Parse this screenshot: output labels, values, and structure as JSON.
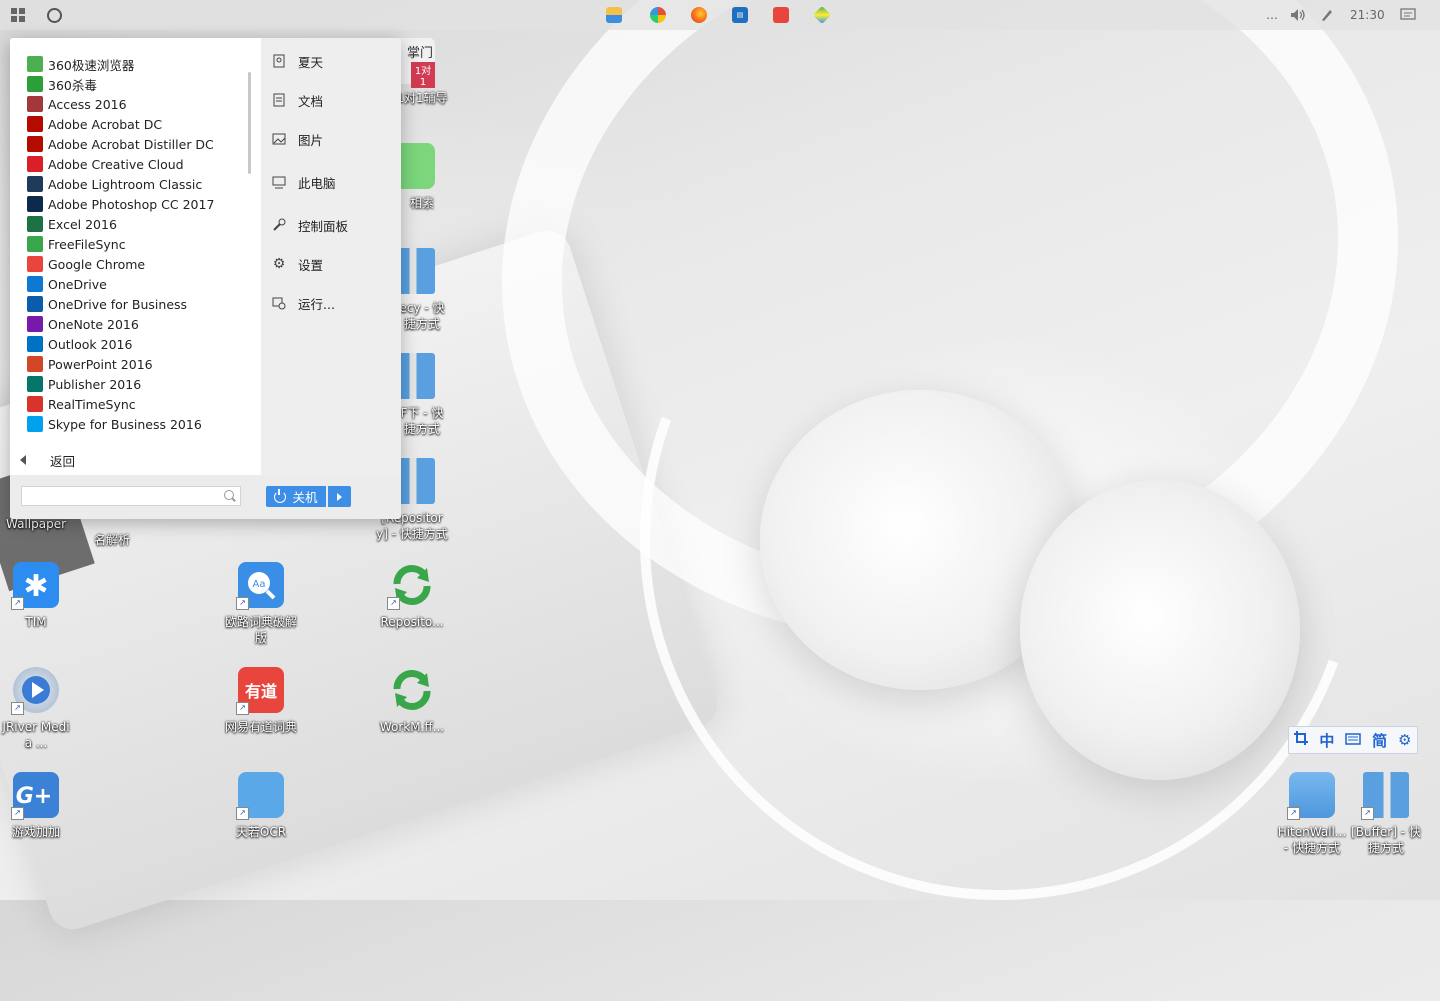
{
  "taskbar": {
    "pinned": [
      "folder-icon",
      "360-browser-icon",
      "firefox-icon",
      "dictionary-icon",
      "youdao-icon",
      "maps-icon"
    ],
    "tray": {
      "more": "…",
      "time": "21:30"
    }
  },
  "start_menu": {
    "apps": [
      {
        "label": "360极速浏览器",
        "icon": "360-browser-icon",
        "color": "#4caf50"
      },
      {
        "label": "360杀毒",
        "icon": "360-antivirus-icon",
        "color": "#2e9e3a"
      },
      {
        "label": "Access 2016",
        "icon": "access-icon",
        "color": "#a4373a"
      },
      {
        "label": "Adobe Acrobat DC",
        "icon": "acrobat-icon",
        "color": "#b30b00"
      },
      {
        "label": "Adobe Acrobat Distiller DC",
        "icon": "distiller-icon",
        "color": "#b30b00"
      },
      {
        "label": "Adobe Creative Cloud",
        "icon": "creative-cloud-icon",
        "color": "#da1f26"
      },
      {
        "label": "Adobe Lightroom Classic",
        "icon": "lightroom-icon",
        "color": "#1f3a5a"
      },
      {
        "label": "Adobe Photoshop CC 2017",
        "icon": "photoshop-icon",
        "color": "#0d2a4a"
      },
      {
        "label": "Excel 2016",
        "icon": "excel-icon",
        "color": "#1e7145"
      },
      {
        "label": "FreeFileSync",
        "icon": "freefilesync-icon",
        "color": "#3aa64a"
      },
      {
        "label": "Google Chrome",
        "icon": "chrome-icon",
        "color": "#e8453c"
      },
      {
        "label": "OneDrive",
        "icon": "onedrive-icon",
        "color": "#0f78d4"
      },
      {
        "label": "OneDrive for Business",
        "icon": "onedrive-business-icon",
        "color": "#0b5cad"
      },
      {
        "label": "OneNote 2016",
        "icon": "onenote-icon",
        "color": "#7719aa"
      },
      {
        "label": "Outlook 2016",
        "icon": "outlook-icon",
        "color": "#0072c6"
      },
      {
        "label": "PowerPoint 2016",
        "icon": "powerpoint-icon",
        "color": "#d24726"
      },
      {
        "label": "Publisher 2016",
        "icon": "publisher-icon",
        "color": "#077568"
      },
      {
        "label": "RealTimeSync",
        "icon": "realtimesync-icon",
        "color": "#d9342b"
      },
      {
        "label": "Skype for Business 2016",
        "icon": "skype-icon",
        "color": "#00a2ed"
      }
    ],
    "back_label": "返回",
    "places": [
      {
        "label": "夏天",
        "icon": "user-icon"
      },
      {
        "label": "文档",
        "icon": "document-icon"
      },
      {
        "label": "图片",
        "icon": "picture-icon"
      },
      {
        "label": "此电脑",
        "icon": "computer-icon"
      },
      {
        "label": "控制面板",
        "icon": "wrench-icon"
      },
      {
        "label": "设置",
        "icon": "gear-icon"
      },
      {
        "label": "运行...",
        "icon": "run-icon"
      }
    ],
    "search_value": "",
    "power_label": "关机"
  },
  "desktop": {
    "partial_top": [
      "掌门",
      "1对1",
      "1对1辅导",
      "相素",
      "ecy - 快捷方式",
      "F下 - 快捷方式",
      "[Repository] - 快捷方式",
      "Wallpaper",
      "名解析"
    ],
    "icons": [
      {
        "label": "TIM",
        "icon": "tim-icon",
        "color": "#2d8cf0"
      },
      {
        "label": "欧路词典破解版",
        "icon": "eudic-icon",
        "color": "#3a8ee6"
      },
      {
        "label": "Reposito...",
        "icon": "sync-icon",
        "color": "#36a84a"
      },
      {
        "label": "JRiver Media ...",
        "icon": "jriver-icon",
        "color": "#3a7bd5"
      },
      {
        "label": "网易有道词典",
        "icon": "youdao-icon",
        "color": "#e8453c"
      },
      {
        "label": "WorkM.ff...",
        "icon": "sync-icon",
        "color": "#36a84a"
      },
      {
        "label": "游戏加加",
        "icon": "game-plus-icon",
        "color": "#3b82d6"
      },
      {
        "label": "天若OCR",
        "icon": "ocr-icon",
        "color": "#5aa8e8"
      },
      {
        "label": "HitenWall... - 快捷方式",
        "icon": "folder-icon",
        "color": "#4e97dc"
      },
      {
        "label": "[Buffer] - 快捷方式",
        "icon": "folder-zip-icon",
        "color": "#4e97dc"
      }
    ]
  },
  "ime": {
    "items": [
      "中",
      "简"
    ]
  }
}
